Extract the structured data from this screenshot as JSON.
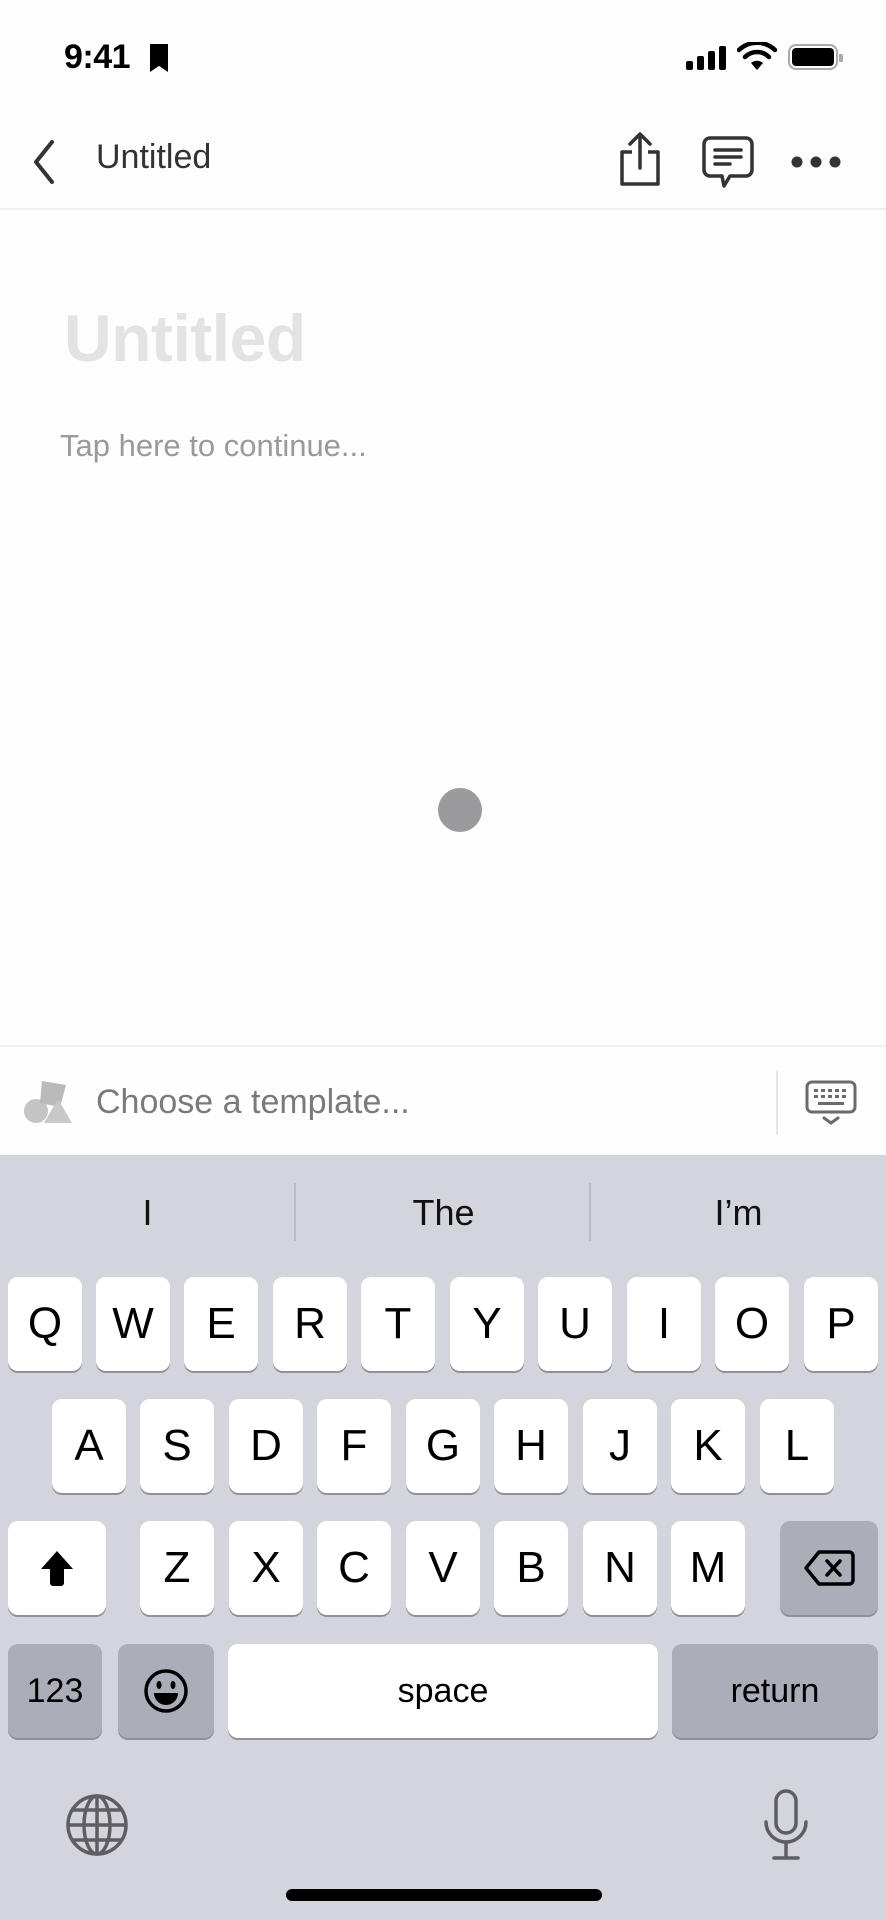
{
  "status_bar": {
    "time": "9:41",
    "icons": [
      "bookmark-icon",
      "cellular-signal-icon",
      "wifi-icon",
      "battery-icon"
    ]
  },
  "nav_bar": {
    "title": "Untitled",
    "back_icon": "chevron-left-icon",
    "actions": [
      "share-icon",
      "comment-icon",
      "more-icon"
    ]
  },
  "page": {
    "title_placeholder": "Untitled",
    "body_placeholder": "Tap here to continue..."
  },
  "template_bar": {
    "label": "Choose a template...",
    "icon": "template-shapes-icon",
    "dismiss_icon": "keyboard-dismiss-icon"
  },
  "keyboard": {
    "suggestions": [
      "I",
      "The",
      "I’m"
    ],
    "row1": [
      "Q",
      "W",
      "E",
      "R",
      "T",
      "Y",
      "U",
      "I",
      "O",
      "P"
    ],
    "row2": [
      "A",
      "S",
      "D",
      "F",
      "G",
      "H",
      "J",
      "K",
      "L"
    ],
    "row3": [
      "Z",
      "X",
      "C",
      "V",
      "B",
      "N",
      "M"
    ],
    "numbers_label": "123",
    "space_label": "space",
    "return_label": "return",
    "shift_icon": "shift-icon",
    "delete_icon": "delete-icon",
    "emoji_icon": "emoji-icon",
    "globe_icon": "globe-icon",
    "mic_icon": "microphone-icon"
  },
  "colors": {
    "keyboard_bg": "#d3d4dc",
    "key_light": "#ffffff",
    "key_dark": "#abaeb9",
    "placeholder_text": "#9a9a9a",
    "title_placeholder": "#e3e3e3"
  }
}
